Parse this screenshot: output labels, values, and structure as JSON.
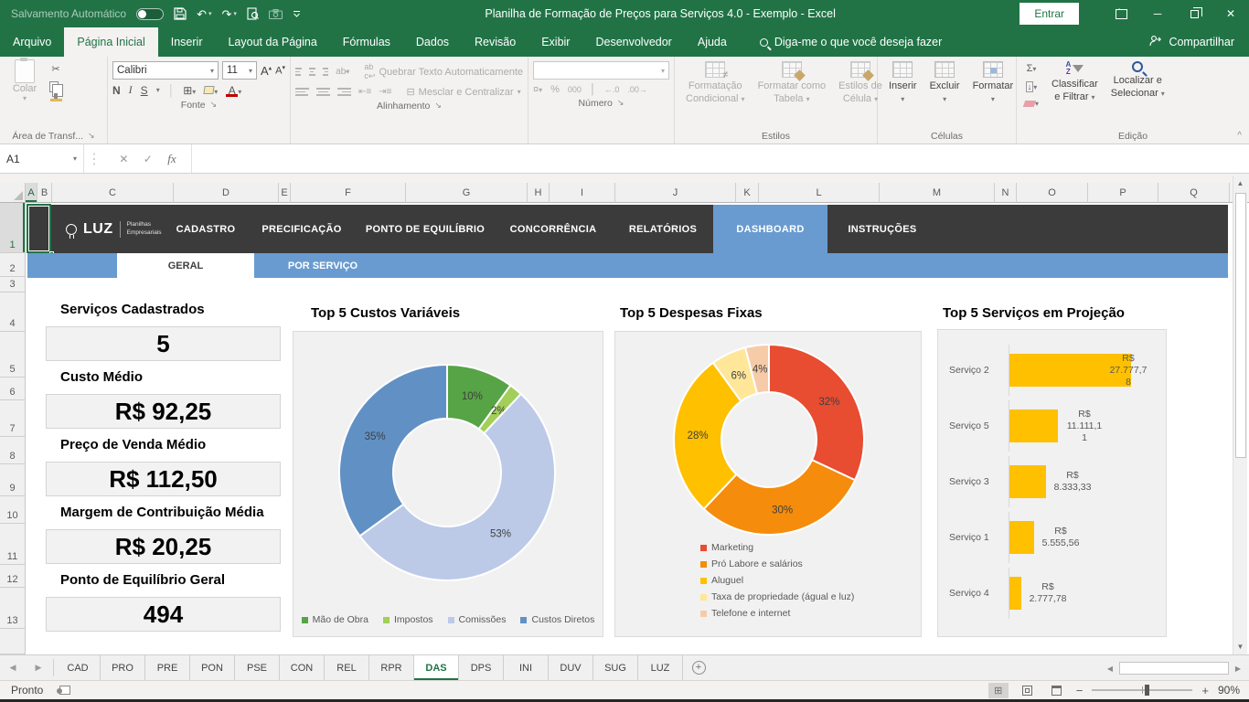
{
  "colors": {
    "excel_green": "#217346",
    "nav_dark": "#3b3b3b",
    "accent_blue": "#699bd0",
    "bar_amber": "#FFC000"
  },
  "title_bar": {
    "autosave_label": "Salvamento Automático",
    "title": "Planilha de Formação de Preços para Serviços 4.0 - Exemplo - Excel",
    "sign_in_label": "Entrar"
  },
  "ribbon_tabs": [
    "Arquivo",
    "Página Inicial",
    "Inserir",
    "Layout da Página",
    "Fórmulas",
    "Dados",
    "Revisão",
    "Exibir",
    "Desenvolvedor",
    "Ajuda"
  ],
  "search_label": "Diga-me o que você deseja fazer",
  "share_label": "Compartilhar",
  "ribbon": {
    "clipboard": {
      "group": "Área de Transf...",
      "paste": "Colar"
    },
    "font": {
      "group": "Fonte",
      "font_name": "Calibri",
      "font_size": "11",
      "bold": "N",
      "italic": "I",
      "underline": "S"
    },
    "alignment": {
      "group": "Alinhamento",
      "wrap": "Quebrar Texto Automaticamente",
      "merge": "Mesclar e Centralizar"
    },
    "number": {
      "group": "Número",
      "percent": "%",
      "thousands": "000",
      "dec_left": "←.0",
      "dec_right": ".00→"
    },
    "styles": {
      "group": "Estilos",
      "conditional_1": "Formatação",
      "conditional_2": "Condicional",
      "table_1": "Formatar como",
      "table_2": "Tabela",
      "cell_1": "Estilos de",
      "cell_2": "Célula"
    },
    "cells": {
      "group": "Células",
      "insert": "Inserir",
      "delete": "Excluir",
      "format": "Formatar"
    },
    "editing": {
      "group": "Edição",
      "sort_1": "Classificar",
      "sort_2": "e Filtrar",
      "find_1": "Localizar e",
      "find_2": "Selecionar"
    }
  },
  "formula_bar": {
    "name_box": "A1",
    "formula": "",
    "fx": "fx"
  },
  "grid": {
    "columns": [
      "A",
      "B",
      "C",
      "D",
      "E",
      "F",
      "G",
      "H",
      "I",
      "J",
      "K",
      "L",
      "M",
      "N",
      "O",
      "P",
      "Q"
    ],
    "rows": [
      "1",
      "2",
      "3",
      "4",
      "5",
      "6",
      "7",
      "8",
      "9",
      "10",
      "11",
      "12",
      "13"
    ],
    "selected_cell": "A1",
    "selected_column": "A",
    "selected_row": "1"
  },
  "nav": {
    "brand": "LUZ",
    "brand_sub1": "Planilhas",
    "brand_sub2": "Empresariais",
    "items": [
      {
        "label": "CADASTRO",
        "active": false
      },
      {
        "label": "PRECIFICAÇÃO",
        "active": false
      },
      {
        "label": "PONTO DE EQUILÍBRIO",
        "active": false
      },
      {
        "label": "CONCORRÊNCIA",
        "active": false
      },
      {
        "label": "RELATÓRIOS",
        "active": false
      },
      {
        "label": "DASHBOARD",
        "active": true
      },
      {
        "label": "INSTRUÇÕES",
        "active": false
      }
    ]
  },
  "subtabs": [
    {
      "label": "GERAL",
      "active": true
    },
    {
      "label": "POR SERVIÇO",
      "active": false
    }
  ],
  "metrics": [
    {
      "label": "Serviços Cadastrados",
      "value": "5"
    },
    {
      "label": "Custo Médio",
      "value": "R$ 92,25"
    },
    {
      "label": "Preço de Venda Médio",
      "value": "R$ 112,50"
    },
    {
      "label": "Margem de Contribuição Média",
      "value": "R$ 20,25"
    },
    {
      "label": "Ponto de Equilíbrio Geral",
      "value": "494"
    }
  ],
  "chart_data": [
    {
      "type": "pie",
      "subtype": "donut",
      "title": "Top 5 Custos Variáveis",
      "labels": [
        "Mão de Obra",
        "Impostos",
        "Comissões",
        "Custos Diretos"
      ],
      "values": [
        10,
        2,
        53,
        35
      ],
      "value_labels": [
        "10%",
        "2%",
        "53%",
        "35%"
      ],
      "colors": [
        "#56A446",
        "#A2CE5A",
        "#BCCAE8",
        "#6191C4"
      ],
      "legend_position": "bottom"
    },
    {
      "type": "pie",
      "subtype": "donut",
      "title": "Top 5 Despesas Fixas",
      "labels": [
        "Marketing",
        "Pró Labore e salários",
        "Aluguel",
        "Taxa de propriedade (águal e luz)",
        "Telefone e internet"
      ],
      "values": [
        32,
        30,
        28,
        6,
        4
      ],
      "value_labels": [
        "32%",
        "30%",
        "28%",
        "6%",
        "4%"
      ],
      "colors": [
        "#E84C31",
        "#F58C0C",
        "#FFC000",
        "#FFE699",
        "#F6CBA8"
      ],
      "legend_position": "bottom-left-vertical"
    },
    {
      "type": "bar",
      "orientation": "horizontal",
      "title": "Top 5 Serviços em Projeção",
      "categories": [
        "Serviço 2",
        "Serviço 5",
        "Serviço 3",
        "Serviço 1",
        "Serviço 4"
      ],
      "values": [
        27777.78,
        11111.11,
        8333.33,
        5555.56,
        2777.78
      ],
      "value_labels": [
        "R$ 27.777,78",
        "R$ 11.111,11",
        "R$ 8.333,33",
        "R$ 5.555,56",
        "R$ 2.777,78"
      ],
      "value_label_lines": [
        [
          "R$",
          "27.777,7",
          "8"
        ],
        [
          "R$",
          "11.111,1",
          "1"
        ],
        [
          "R$",
          "8.333,33"
        ],
        [
          "R$",
          "5.555,56"
        ],
        [
          "R$",
          "2.777,78"
        ]
      ],
      "color": "#FFC000",
      "xlim": [
        0,
        30000
      ],
      "grid": false,
      "legend_position": "none"
    }
  ],
  "sheet_tabs": {
    "tabs": [
      "CAD",
      "PRO",
      "PRE",
      "PON",
      "PSE",
      "CON",
      "REL",
      "RPR",
      "DAS",
      "DPS",
      "INI",
      "DUV",
      "SUG",
      "LUZ"
    ],
    "active": "DAS"
  },
  "status_bar": {
    "status": "Pronto",
    "zoom": "90%"
  }
}
